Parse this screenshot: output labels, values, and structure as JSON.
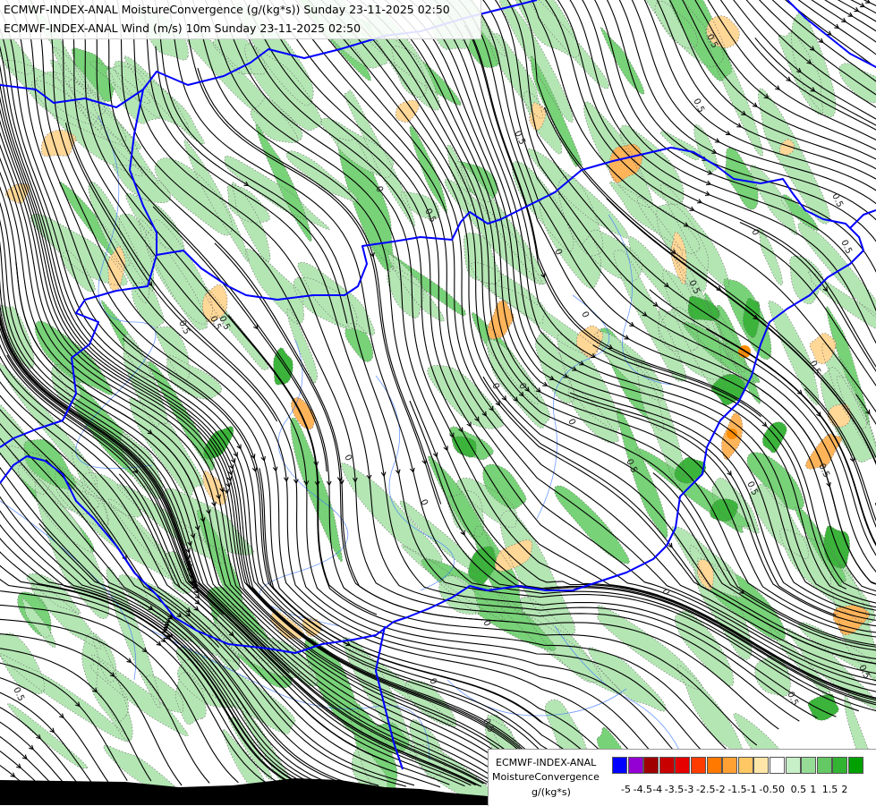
{
  "header": {
    "title_line1": "ECMWF-INDEX-ANAL MoistureConvergence (g/(kg*s)) Sunday 23-11-2025 02:50",
    "title_line2": "ECMWF-INDEX-ANAL Wind (m/s) 10m Sunday 23-11-2025 02:50"
  },
  "legend": {
    "line1": "ECMWF-INDEX-ANAL",
    "line2": "MoistureConvergence",
    "line3": "g/(kg*s)",
    "colors": [
      "#0000ff",
      "#9400d3",
      "#a00000",
      "#c80000",
      "#e60000",
      "#ff3c00",
      "#ff7800",
      "#ffa032",
      "#ffc864",
      "#ffe6a8",
      "#ffffff",
      "#c8f0c8",
      "#96dc96",
      "#64c864",
      "#32b432",
      "#00a000"
    ],
    "ticks": [
      "-5",
      "-4.5",
      "-4",
      "-3.5",
      "-3",
      "-2.5",
      "-2",
      "-1.5",
      "-1",
      "-0.5",
      "0",
      "0.5",
      "1",
      "1.5",
      "2"
    ]
  },
  "map": {
    "contour_labels": [
      "0.5",
      "0.5",
      "0.5",
      "0",
      "0",
      "0.5",
      "0.5",
      "0",
      "0.5",
      "0",
      "0.5",
      "0",
      "0.5",
      "0",
      "0.5",
      "0.5",
      "0",
      "0.5",
      "0",
      "0.5",
      "0",
      "0.5",
      "0",
      "0.5",
      "0",
      "0.5",
      "0.5",
      "0",
      "0.5",
      "0.5"
    ],
    "colors": {
      "border": "#0000ff",
      "river": "#3c78ff",
      "streamline": "#000000",
      "green_light": "#b4e6b4",
      "green_mid": "#78d278",
      "green_dark": "#3cb43c",
      "orange_light": "#ffd796",
      "orange_mid": "#ffb45a"
    }
  }
}
